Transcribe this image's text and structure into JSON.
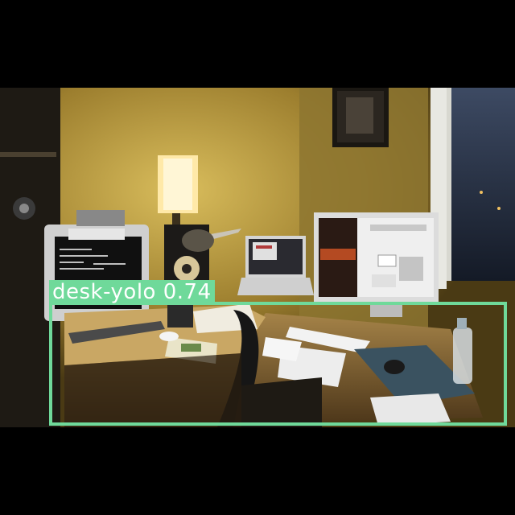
{
  "detection": {
    "label": "desk-yolo 0.74",
    "box_color": "#6fd99a",
    "text_color": "#ffffff"
  },
  "scene": {
    "wall_color": "#b89a3c",
    "desk_color": "#8a6a34",
    "window_color": "#2a3548"
  }
}
